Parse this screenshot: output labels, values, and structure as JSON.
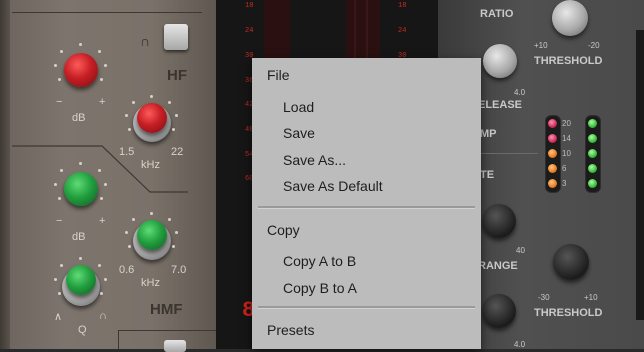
{
  "eq": {
    "hf_label": "HF",
    "hmf_label": "HMF",
    "db_label": "dB",
    "khz_label": "kHz",
    "q_label": "Q",
    "minus": "−",
    "plus": "+",
    "hf_freq_min": "1.5",
    "hf_freq_max": "22",
    "hmf_freq_min": "0.6",
    "hmf_freq_max": "7.0",
    "shelf_glyph": "∩",
    "q_low_glyph": "∧",
    "q_high_glyph": "∩"
  },
  "meter": {
    "left_scale": [
      "18",
      "24",
      "30",
      "36",
      "42",
      "48",
      "54",
      "60"
    ],
    "right_scale": [
      "18",
      "24",
      "30"
    ],
    "digit": "8"
  },
  "comp": {
    "ratio_label": "RATIO",
    "threshold_label": "THRESHOLD",
    "threshold_min": "+10",
    "threshold_max": "-20",
    "release_label": "ELEASE",
    "release_value": "4.0",
    "amp_label": "MP",
    "gate_label": "TE",
    "range_label": "RANGE",
    "range_value": "40",
    "threshold2_label": "THRESHOLD",
    "threshold2_min": "-30",
    "threshold2_max": "+10",
    "bottom_value": "4.0",
    "gr_scale": [
      "20",
      "14",
      "10",
      "6",
      "3"
    ]
  },
  "menu": {
    "file_header": "File",
    "load": "Load",
    "save": "Save",
    "save_as": "Save As...",
    "save_as_default": "Save As Default",
    "copy_header": "Copy",
    "copy_a_to_b": "Copy A to B",
    "copy_b_to_a": "Copy B to A",
    "presets_header": "Presets"
  }
}
